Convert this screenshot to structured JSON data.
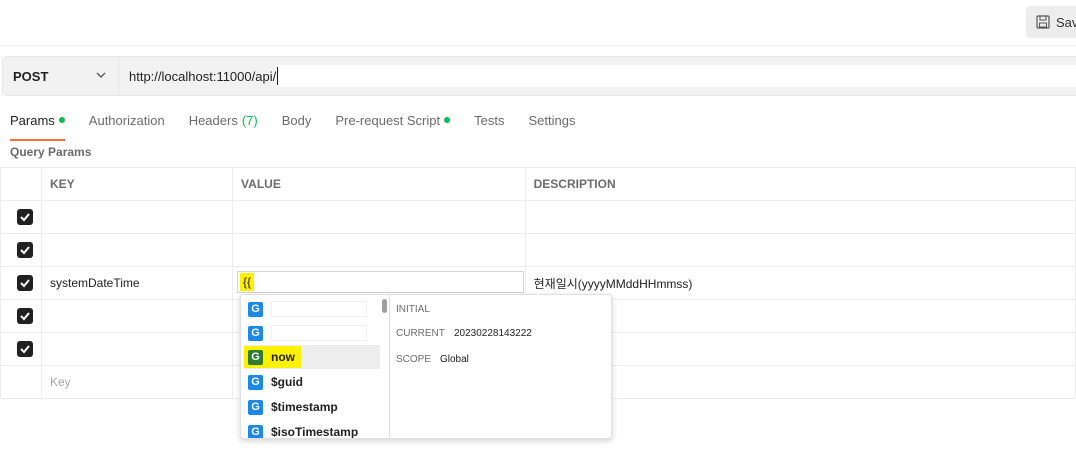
{
  "toolbar": {
    "save_label": "Sav"
  },
  "request": {
    "method": "POST",
    "url": "http://localhost:11000/api/"
  },
  "tabs": [
    {
      "label": "Params",
      "dot": true,
      "active": true
    },
    {
      "label": "Authorization"
    },
    {
      "label": "Headers",
      "count": "(7)"
    },
    {
      "label": "Body"
    },
    {
      "label": "Pre-request Script",
      "dot": true
    },
    {
      "label": "Tests"
    },
    {
      "label": "Settings"
    }
  ],
  "query_params": {
    "title": "Query Params",
    "headers": {
      "key": "KEY",
      "value": "VALUE",
      "description": "DESCRIPTION"
    },
    "rows": [
      {
        "checked": true,
        "key": "",
        "value": "",
        "description": ""
      },
      {
        "checked": true,
        "key": "",
        "value": "",
        "description": ""
      },
      {
        "checked": true,
        "key": "systemDateTime",
        "value": "{{",
        "description": "현재일시(yyyyMMddHHmmss)"
      },
      {
        "checked": true,
        "key": "",
        "value": "",
        "description": ""
      },
      {
        "checked": true,
        "key": "",
        "value": "",
        "description": ""
      }
    ],
    "placeholder_key": "Key"
  },
  "autocomplete": {
    "badge": "G",
    "items": [
      {
        "label": ""
      },
      {
        "label": ""
      },
      {
        "label": "now",
        "selected": true
      },
      {
        "label": "$guid"
      },
      {
        "label": "$timestamp"
      },
      {
        "label": "$isoTimestamp"
      }
    ],
    "detail": {
      "initial_label": "INITIAL",
      "initial_value": "",
      "current_label": "CURRENT",
      "current_value": "20230228143222",
      "scope_label": "SCOPE",
      "scope_value": "Global"
    }
  },
  "colors": {
    "accent_tab": "#ff6c37",
    "green_dot": "#0cbb52",
    "badge_blue": "#1e88e5",
    "badge_green": "#2e7d32",
    "highlight": "#fff200"
  }
}
